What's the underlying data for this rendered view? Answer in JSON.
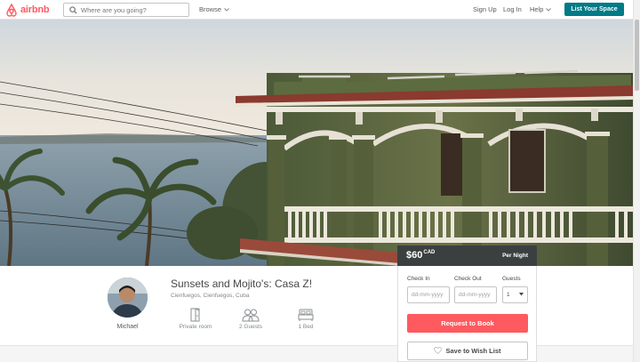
{
  "header": {
    "logo_text": "airbnb",
    "search_placeholder": "Where are you going?",
    "browse_label": "Browse",
    "signup_label": "Sign Up",
    "login_label": "Log In",
    "help_label": "Help",
    "list_space_label": "List Your Space"
  },
  "listing": {
    "title": "Sunsets and Mojito's: Casa Z!",
    "location": "Cienfuegos, Cienfuegos, Cuba",
    "host_name": "Michael",
    "amenities": [
      {
        "icon": "door-icon",
        "label": "Private room"
      },
      {
        "icon": "guests-icon",
        "label": "2 Guests"
      },
      {
        "icon": "bed-icon",
        "label": "1 Bed"
      }
    ]
  },
  "booking": {
    "price": "$60",
    "currency": "CAD",
    "per_night_label": "Per Night",
    "check_in_label": "Check In",
    "check_out_label": "Check Out",
    "guests_label": "Guests",
    "date_placeholder": "dd-mm-yyyy",
    "guests_value": "1",
    "request_label": "Request to Book",
    "wishlist_label": "Save to Wish List"
  },
  "colors": {
    "brand": "#ff5a5f",
    "teal": "#007a87",
    "price_bar": "#3c3f40"
  }
}
